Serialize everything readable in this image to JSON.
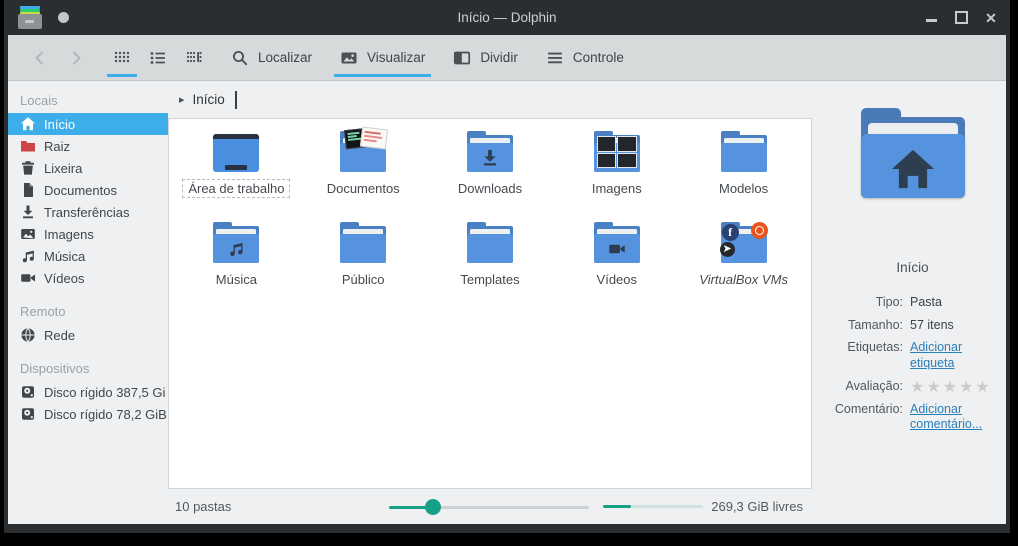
{
  "window": {
    "title": "Início — Dolphin"
  },
  "toolbar": {
    "localizar": "Localizar",
    "visualizar": "Visualizar",
    "dividir": "Dividir",
    "controle": "Controle"
  },
  "breadcrumb": {
    "current": "Início"
  },
  "sidebar": {
    "sections": [
      {
        "label": "Locais",
        "items": [
          {
            "label": "Início",
            "icon": "home",
            "selected": true
          },
          {
            "label": "Raiz",
            "icon": "folder-red"
          },
          {
            "label": "Lixeira",
            "icon": "trash"
          },
          {
            "label": "Documentos",
            "icon": "document"
          },
          {
            "label": "Transferências",
            "icon": "download"
          },
          {
            "label": "Imagens",
            "icon": "image"
          },
          {
            "label": "Música",
            "icon": "music"
          },
          {
            "label": "Vídeos",
            "icon": "video"
          }
        ]
      },
      {
        "label": "Remoto",
        "items": [
          {
            "label": "Rede",
            "icon": "globe"
          }
        ]
      },
      {
        "label": "Dispositivos",
        "items": [
          {
            "label": "Disco rígido 387,5 Gi",
            "icon": "harddisk"
          },
          {
            "label": "Disco rígido 78,2 GiB",
            "icon": "harddisk"
          }
        ]
      }
    ]
  },
  "folders": [
    {
      "label": "Área de trabalho",
      "kind": "desktop",
      "focused": true
    },
    {
      "label": "Documentos",
      "kind": "documents"
    },
    {
      "label": "Downloads",
      "kind": "downloads"
    },
    {
      "label": "Imagens",
      "kind": "images"
    },
    {
      "label": "Modelos",
      "kind": "plain"
    },
    {
      "label": "Música",
      "kind": "music"
    },
    {
      "label": "Público",
      "kind": "plain"
    },
    {
      "label": "Templates",
      "kind": "plain"
    },
    {
      "label": "Vídeos",
      "kind": "videos"
    },
    {
      "label": "VirtualBox VMs",
      "kind": "virtualbox",
      "italic": true
    }
  ],
  "info_panel": {
    "title": "Início",
    "rows": [
      {
        "label": "Tipo:",
        "value": "Pasta",
        "type": "text"
      },
      {
        "label": "Tamanho:",
        "value": "57 itens",
        "type": "text"
      },
      {
        "label": "Etiquetas:",
        "value": "Adicionar etiqueta",
        "type": "link"
      },
      {
        "label": "Avaliação:",
        "value": "",
        "type": "stars",
        "star_count": 5
      },
      {
        "label": "Comentário:",
        "value": "Adicionar comentário...",
        "type": "link"
      }
    ]
  },
  "statusbar": {
    "folders_count": "10 pastas",
    "free_space": "269,3 GiB livres",
    "zoom_slider_percent": 22,
    "capacity_percent": 28
  },
  "colors": {
    "accent_blue": "#3daee9",
    "link_blue": "#2980b9",
    "slider_teal": "#16a085",
    "titlebar": "#2b2e31",
    "toolbar_bg": "#d7dadb",
    "window_bg": "#eff0f1",
    "folder_front": "#5593de",
    "folder_back": "#4a80c4"
  }
}
